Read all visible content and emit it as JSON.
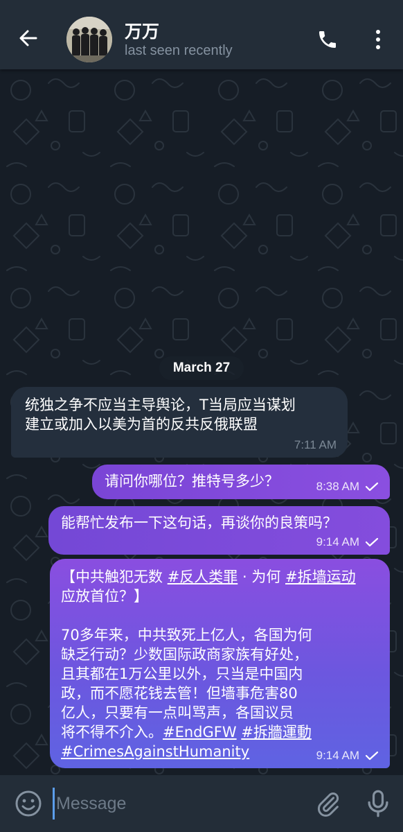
{
  "header": {
    "contact_name": "万万",
    "status": "last seen recently"
  },
  "chat": {
    "date_separator": "March 27",
    "messages": [
      {
        "direction": "incoming",
        "text": "统独之争不应当主导舆论，T当局应当谋划\n建立或加入以美为首的反共反俄联盟",
        "time": "7:11 AM"
      },
      {
        "direction": "outgoing",
        "text": "请问你哪位？推特号多少？",
        "time": "8:38 AM"
      },
      {
        "direction": "outgoing",
        "text": "能帮忙发布一下这句话，再谈你的良策吗？",
        "time": "9:14 AM"
      },
      {
        "direction": "outgoing",
        "time": "9:14 AM",
        "parts": {
          "p1": "【中共触犯无数 ",
          "tag1": "#反人类罪",
          "p2": " · 为何 ",
          "tag2": "#拆墙运动",
          "p3": "\n应放首位？】\n\n70多年来，中共致死上亿人，各国为何\n缺乏行动？少数国际政商家族有好处，\n且其都在1万公里以外，只当是中国内\n政，而不愿花钱去管！但墙事危害80\n亿人，只要有一点叫骂声，各国议员\n将不得不介入。",
          "tag3": "#EndGFW",
          "p4": " ",
          "tag4": "#拆牆運動",
          "p5": "\n",
          "tag5": "#CrimesAgainstHumanity"
        }
      }
    ]
  },
  "composer": {
    "placeholder": "Message"
  },
  "colors": {
    "header_bg": "#232d38",
    "chat_bg": "#161d26",
    "incoming_bubble": "#242f3d",
    "outgoing_bubble": "#7a45d6",
    "accent": "#5b9dea"
  }
}
